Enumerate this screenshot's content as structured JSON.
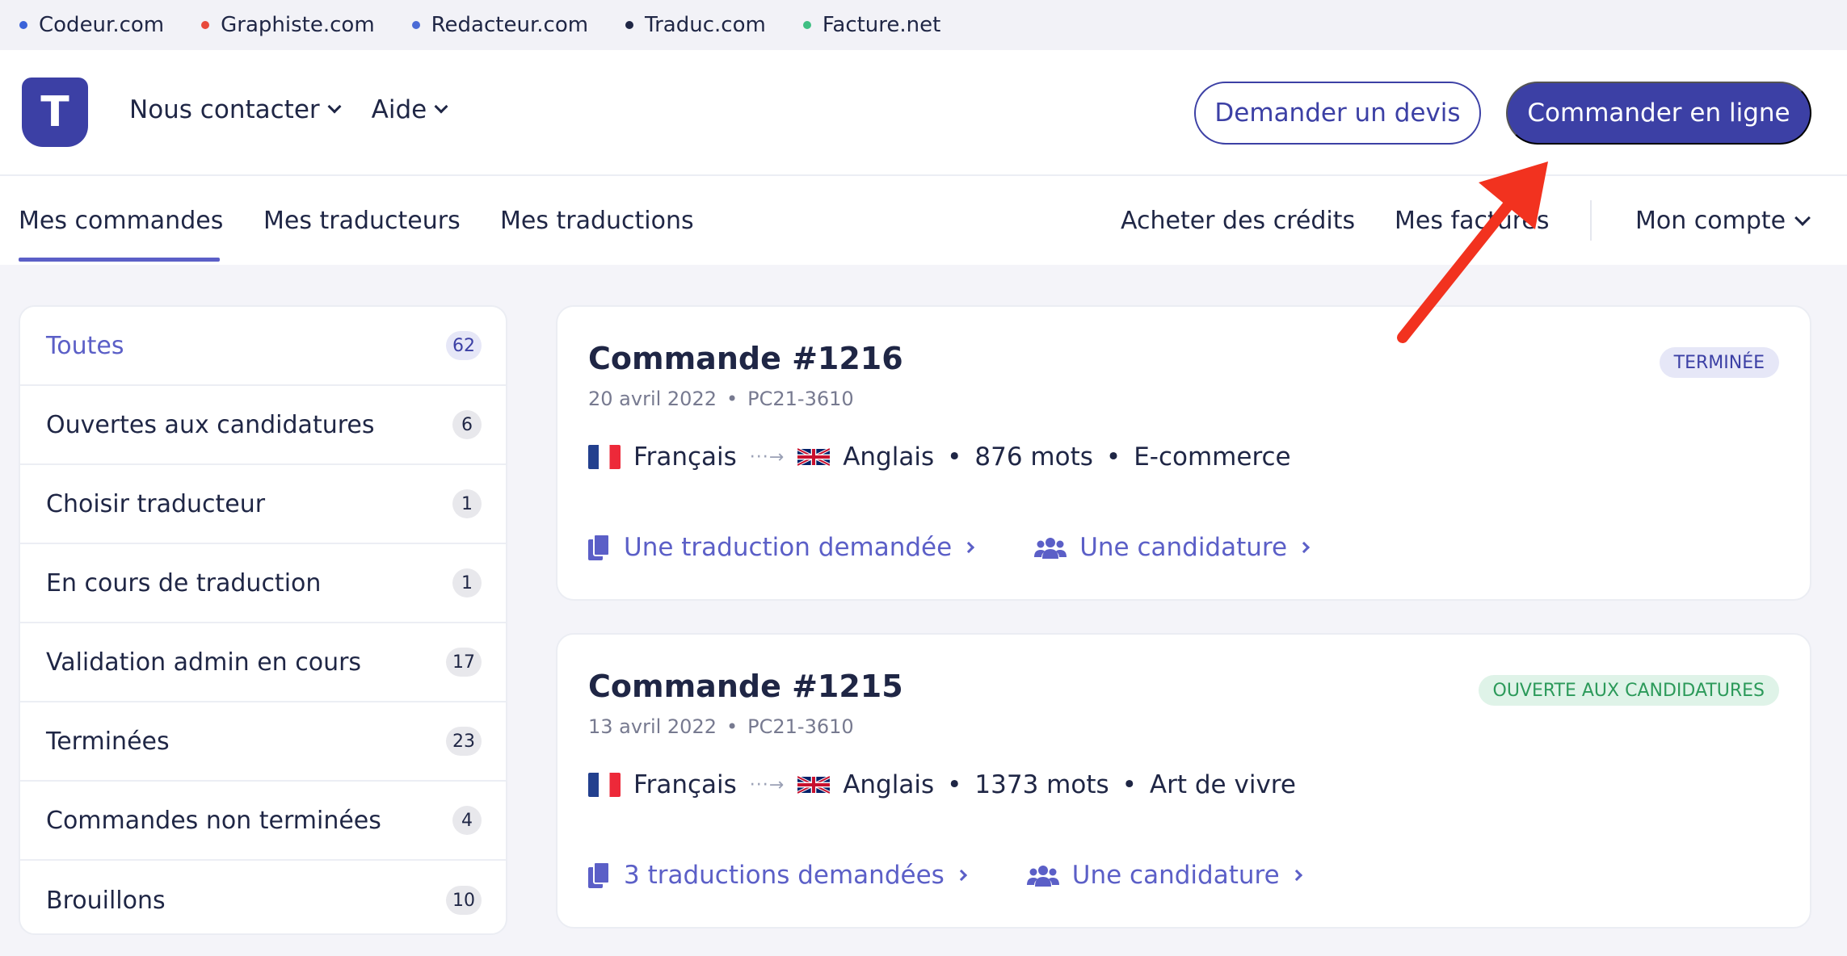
{
  "network": [
    {
      "name": "Codeur.com",
      "color": "#3a62d9"
    },
    {
      "name": "Graphiste.com",
      "color": "#e84a3c"
    },
    {
      "name": "Redacteur.com",
      "color": "#4b6bd6"
    },
    {
      "name": "Traduc.com",
      "color": "#1f2645"
    },
    {
      "name": "Facture.net",
      "color": "#3fbf83"
    }
  ],
  "header": {
    "logo_letter": "T",
    "nav": [
      "Nous contacter",
      "Aide"
    ],
    "quote_button": "Demander un devis",
    "order_button": "Commander en ligne"
  },
  "subnav": {
    "tabs": [
      "Mes commandes",
      "Mes traducteurs",
      "Mes traductions"
    ],
    "right": [
      "Acheter des crédits",
      "Mes factures"
    ],
    "account": "Mon compte"
  },
  "sidebar": {
    "items": [
      {
        "label": "Toutes",
        "count": "62"
      },
      {
        "label": "Ouvertes aux candidatures",
        "count": "6"
      },
      {
        "label": "Choisir traducteur",
        "count": "1"
      },
      {
        "label": "En cours de traduction",
        "count": "1"
      },
      {
        "label": "Validation admin en cours",
        "count": "17"
      },
      {
        "label": "Terminées",
        "count": "23"
      },
      {
        "label": "Commandes non terminées",
        "count": "4"
      },
      {
        "label": "Brouillons",
        "count": "10"
      }
    ]
  },
  "orders": [
    {
      "title": "Commande #1216",
      "date": "20 avril 2022",
      "ref": "PC21-3610",
      "status": "TERMINÉE",
      "source_lang": "Français",
      "target_lang": "Anglais",
      "words": "876 mots",
      "category": "E-commerce",
      "translations_link": "Une traduction demandée",
      "applications_link": "Une candidature"
    },
    {
      "title": "Commande #1215",
      "date": "13 avril 2022",
      "ref": "PC21-3610",
      "status": "OUVERTE AUX CANDIDATURES",
      "source_lang": "Français",
      "target_lang": "Anglais",
      "words": "1373 mots",
      "category": "Art de vivre",
      "translations_link": "3 traductions demandées",
      "applications_link": "Une candidature"
    }
  ],
  "sep": "•"
}
